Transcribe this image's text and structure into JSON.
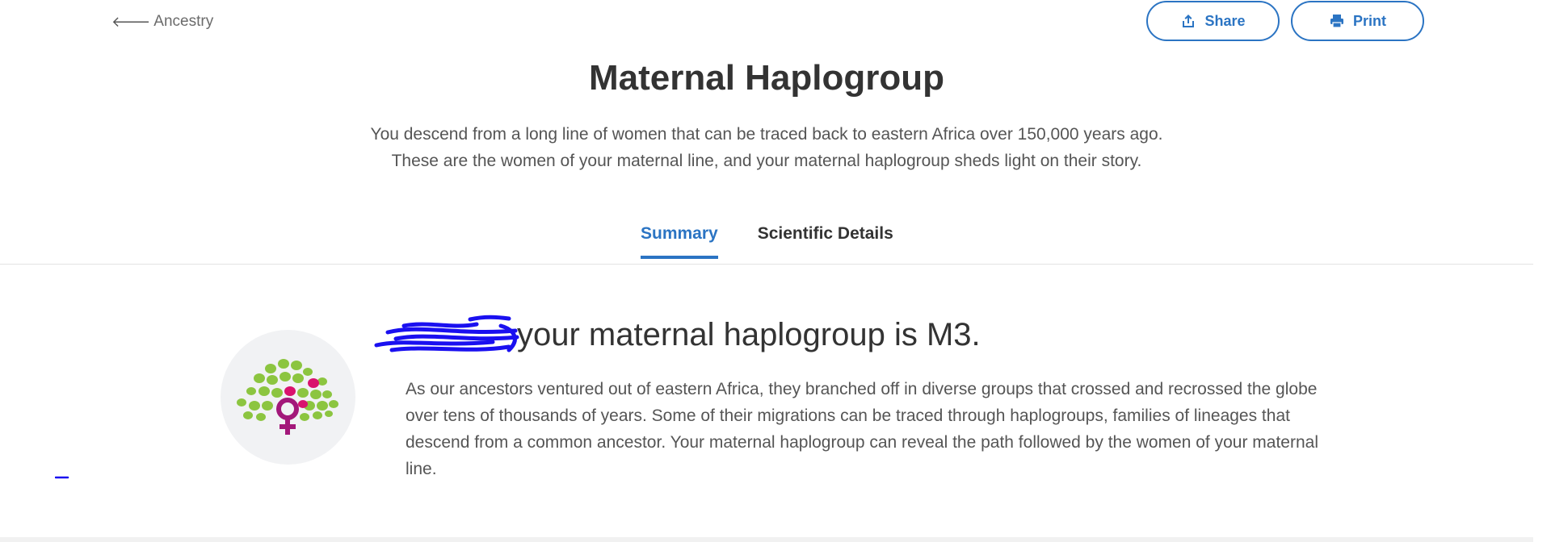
{
  "nav": {
    "back_label": "Ancestry",
    "back_icon": "arrow-left-icon"
  },
  "actions": {
    "share_label": "Share",
    "share_icon": "share-icon",
    "print_label": "Print",
    "print_icon": "printer-icon"
  },
  "header": {
    "title": "Maternal Haplogroup",
    "intro_line1": "You descend from a long line of women that can be traced back to eastern Africa over 150,000 years ago.",
    "intro_line2": "These are the women of your maternal line, and your maternal haplogroup sheds light on their story."
  },
  "tabs": [
    {
      "label": "Summary",
      "active": true
    },
    {
      "label": "Scientific Details",
      "active": false
    }
  ],
  "summary": {
    "heading": "your maternal haplogroup is M3.",
    "description": "As our ancestors ventured out of eastern Africa, they branched off in diverse groups that crossed and recrossed the globe over tens of thousands of years. Some of their migrations can be traced through haplogroups, families of lineages that descend from a common ancestor. Your maternal haplogroup can reveal the path followed by the women of your maternal line.",
    "emblem_icon": "maternal-tree-icon"
  },
  "colors": {
    "accent": "#2b74c3",
    "leaf_green": "#8cc540",
    "leaf_magenta": "#d9136e",
    "female_symbol": "#a3187a",
    "redaction_ink": "#1a10f0"
  }
}
